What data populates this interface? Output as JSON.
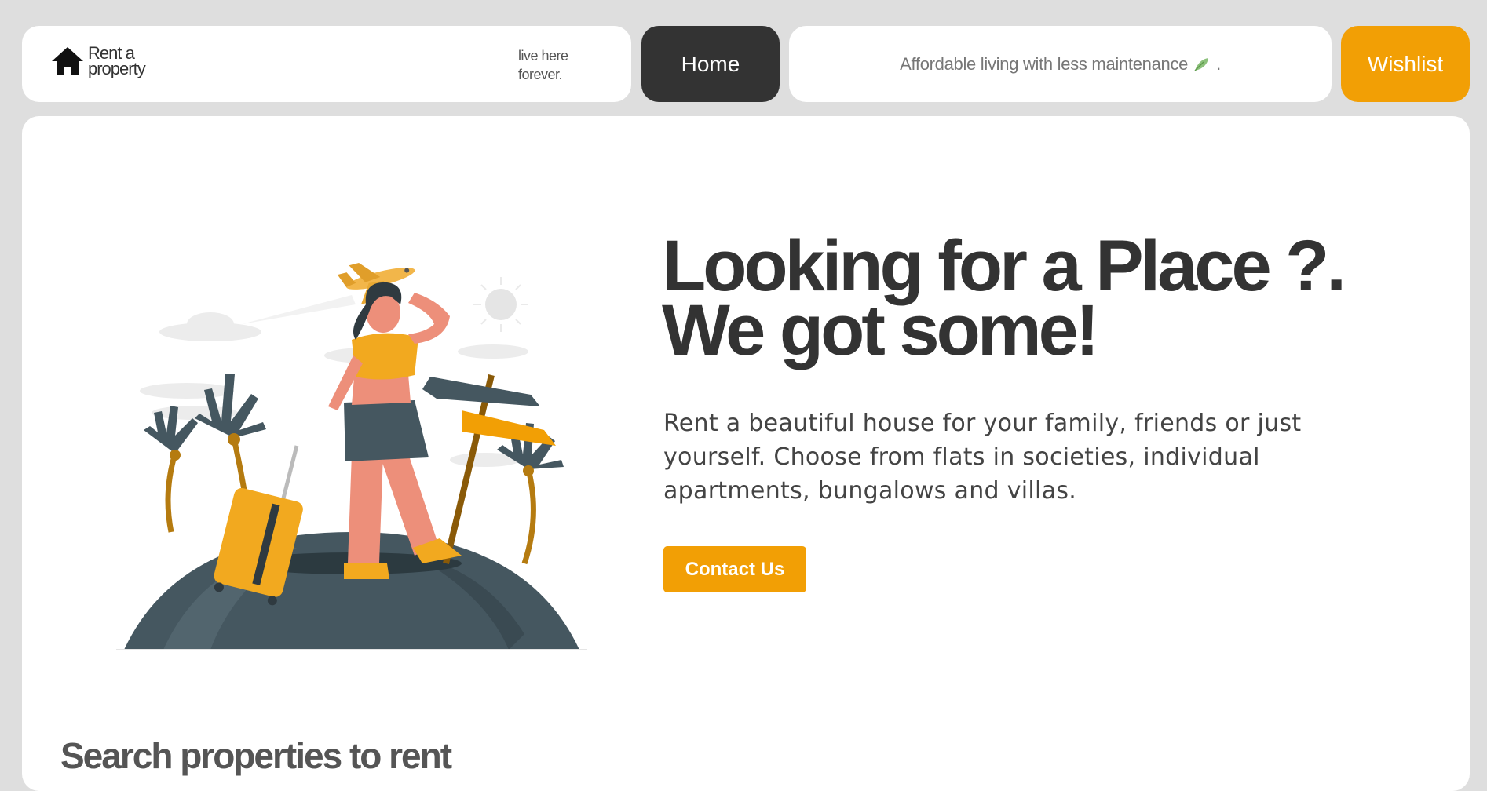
{
  "nav": {
    "brand_name": "Rent a property",
    "brand_line1": "Rent a",
    "brand_line2": "property",
    "tagline_line1": "live here",
    "tagline_line2": "forever.",
    "home_label": "Home",
    "affordable_text": "Affordable living with less maintenance",
    "affordable_suffix": ".",
    "wishlist_label": "Wishlist"
  },
  "hero": {
    "title_line1": "Looking for a Place ?.",
    "title_line2": "We got some!",
    "description": "Rent a beautiful house for your family, friends or just yourself. Choose from flats in societies, individual apartments, bungalows and villas.",
    "contact_label": "Contact Us"
  },
  "search": {
    "title": "Search properties to rent"
  },
  "colors": {
    "accent": "#f29f05",
    "dark": "#333333",
    "background": "#dedede"
  },
  "icons": {
    "logo": "house-icon",
    "leaf": "leaf-icon"
  }
}
